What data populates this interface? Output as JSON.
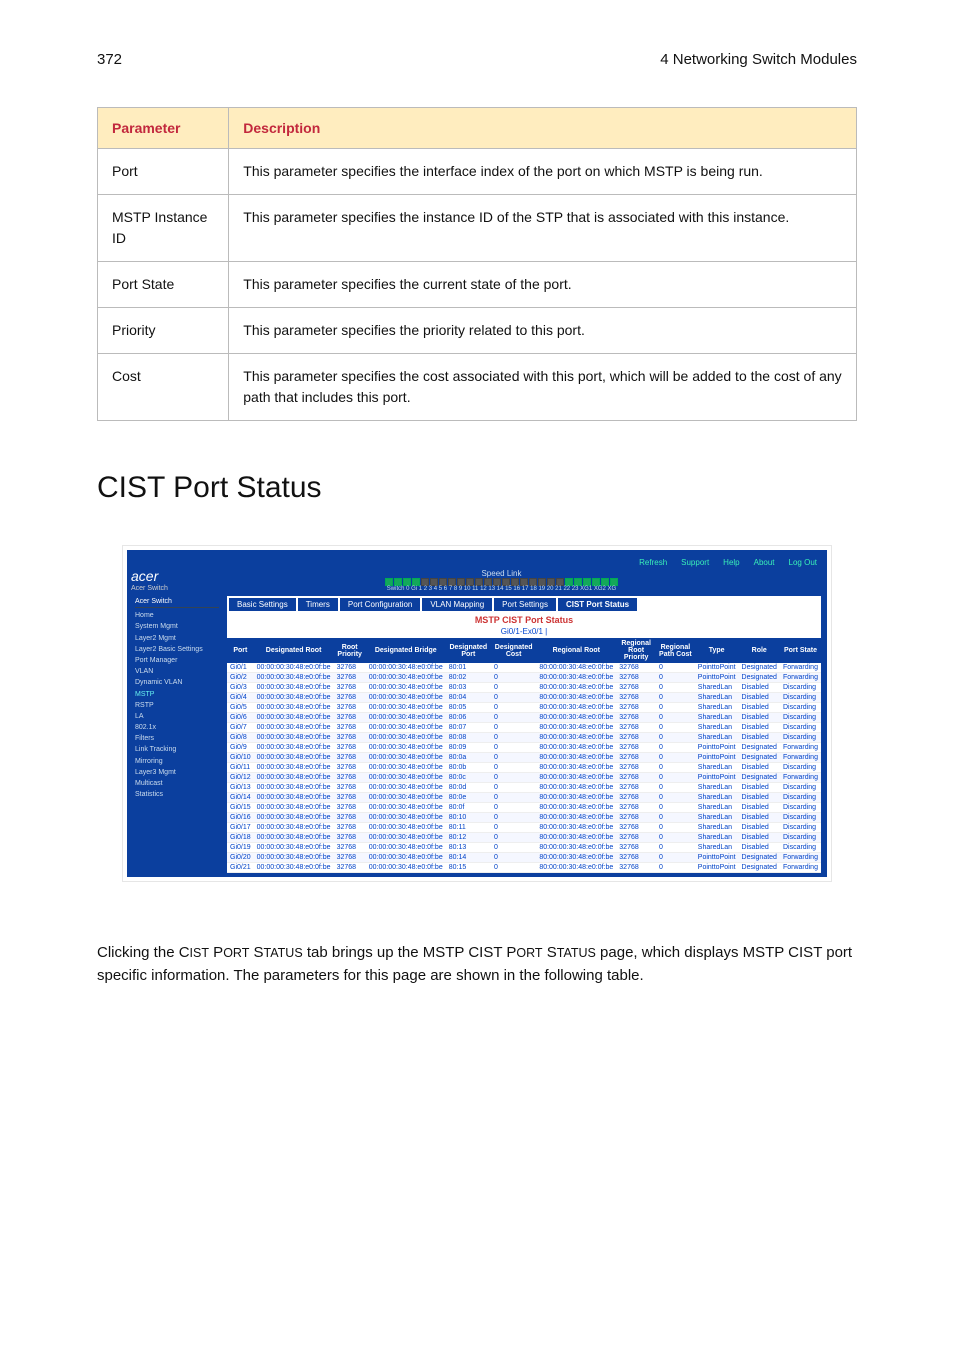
{
  "header": {
    "page_no": "372",
    "chapter": "4 Networking Switch Modules"
  },
  "table": {
    "cols": [
      "Parameter",
      "Description"
    ],
    "rows": [
      {
        "param": "Port",
        "desc": "This parameter specifies the interface index of the port on which MSTP is being run."
      },
      {
        "param": "MSTP Instance ID",
        "desc": "This parameter specifies the instance ID of the STP that is associated with this instance."
      },
      {
        "param": "Port State",
        "desc": "This parameter specifies the current state of the port."
      },
      {
        "param": "Priority",
        "desc": "This parameter specifies the priority related to this port."
      },
      {
        "param": "Cost",
        "desc": "This parameter specifies the cost associated with this port, which will be added to the cost of any path that includes this port."
      }
    ]
  },
  "section_title": "CIST Port Status",
  "screenshot": {
    "brand": "acer",
    "brand_sub": "Acer Switch",
    "top_links": [
      "Refresh",
      "Support",
      "Help",
      "About",
      "Log Out"
    ],
    "speed_label": "Speed Link",
    "speed_caption": "Switch 0 Gi 1 2 3 4 5 6 7 8 9 10 11 12 13 14 15 16 17 18 19 20 21 22 23 XG1 XG2 XG",
    "side_top": "Acer Switch",
    "tabs": [
      "Basic Settings",
      "Timers",
      "Port Configuration",
      "VLAN Mapping",
      "Port Settings",
      "CIST Port Status"
    ],
    "subheader": "MSTP CIST Port Status",
    "link": "Gi0/1-Ex0/1 |",
    "side_items": [
      "Home",
      "System Mgmt",
      "Layer2 Mgmt",
      "Layer2 Basic Settings",
      "Port Manager",
      "VLAN",
      "Dynamic VLAN",
      "MSTP",
      "RSTP",
      "LA",
      "802.1x",
      "Filters",
      "Link Tracking",
      "Mirroring",
      "Layer3 Mgmt",
      "Multicast",
      "Statistics"
    ],
    "cols": [
      "Port",
      "Designated Root",
      "Root Priority",
      "Designated Bridge",
      "Designated Port",
      "Designated Cost",
      "Regional Root",
      "Regional Root Priority",
      "Regional Path Cost",
      "Type",
      "Role",
      "Port State"
    ],
    "rows": [
      {
        "port": "Gi0/1",
        "droot": "00:00:00:30:48:e0:0f:be",
        "rp": "32768",
        "dbridge": "00:00:00:30:48:e0:0f:be",
        "dport": "80:01",
        "dcost": "0",
        "rr": "80:00:00:30:48:e0:0f:be",
        "rrp": "32768",
        "rpc": "0",
        "type": "PointtoPoint",
        "role": "Designated",
        "state": "Forwarding"
      },
      {
        "port": "Gi0/2",
        "droot": "00:00:00:30:48:e0:0f:be",
        "rp": "32768",
        "dbridge": "00:00:00:30:48:e0:0f:be",
        "dport": "80:02",
        "dcost": "0",
        "rr": "80:00:00:30:48:e0:0f:be",
        "rrp": "32768",
        "rpc": "0",
        "type": "PointtoPoint",
        "role": "Designated",
        "state": "Forwarding"
      },
      {
        "port": "Gi0/3",
        "droot": "00:00:00:30:48:e0:0f:be",
        "rp": "32768",
        "dbridge": "00:00:00:30:48:e0:0f:be",
        "dport": "80:03",
        "dcost": "0",
        "rr": "80:00:00:30:48:e0:0f:be",
        "rrp": "32768",
        "rpc": "0",
        "type": "SharedLan",
        "role": "Disabled",
        "state": "Discarding"
      },
      {
        "port": "Gi0/4",
        "droot": "00:00:00:30:48:e0:0f:be",
        "rp": "32768",
        "dbridge": "00:00:00:30:48:e0:0f:be",
        "dport": "80:04",
        "dcost": "0",
        "rr": "80:00:00:30:48:e0:0f:be",
        "rrp": "32768",
        "rpc": "0",
        "type": "SharedLan",
        "role": "Disabled",
        "state": "Discarding"
      },
      {
        "port": "Gi0/5",
        "droot": "00:00:00:30:48:e0:0f:be",
        "rp": "32768",
        "dbridge": "00:00:00:30:48:e0:0f:be",
        "dport": "80:05",
        "dcost": "0",
        "rr": "80:00:00:30:48:e0:0f:be",
        "rrp": "32768",
        "rpc": "0",
        "type": "SharedLan",
        "role": "Disabled",
        "state": "Discarding"
      },
      {
        "port": "Gi0/6",
        "droot": "00:00:00:30:48:e0:0f:be",
        "rp": "32768",
        "dbridge": "00:00:00:30:48:e0:0f:be",
        "dport": "80:06",
        "dcost": "0",
        "rr": "80:00:00:30:48:e0:0f:be",
        "rrp": "32768",
        "rpc": "0",
        "type": "SharedLan",
        "role": "Disabled",
        "state": "Discarding"
      },
      {
        "port": "Gi0/7",
        "droot": "00:00:00:30:48:e0:0f:be",
        "rp": "32768",
        "dbridge": "00:00:00:30:48:e0:0f:be",
        "dport": "80:07",
        "dcost": "0",
        "rr": "80:00:00:30:48:e0:0f:be",
        "rrp": "32768",
        "rpc": "0",
        "type": "SharedLan",
        "role": "Disabled",
        "state": "Discarding"
      },
      {
        "port": "Gi0/8",
        "droot": "00:00:00:30:48:e0:0f:be",
        "rp": "32768",
        "dbridge": "00:00:00:30:48:e0:0f:be",
        "dport": "80:08",
        "dcost": "0",
        "rr": "80:00:00:30:48:e0:0f:be",
        "rrp": "32768",
        "rpc": "0",
        "type": "SharedLan",
        "role": "Disabled",
        "state": "Discarding"
      },
      {
        "port": "Gi0/9",
        "droot": "00:00:00:30:48:e0:0f:be",
        "rp": "32768",
        "dbridge": "00:00:00:30:48:e0:0f:be",
        "dport": "80:09",
        "dcost": "0",
        "rr": "80:00:00:30:48:e0:0f:be",
        "rrp": "32768",
        "rpc": "0",
        "type": "PointtoPoint",
        "role": "Designated",
        "state": "Forwarding"
      },
      {
        "port": "Gi0/10",
        "droot": "00:00:00:30:48:e0:0f:be",
        "rp": "32768",
        "dbridge": "00:00:00:30:48:e0:0f:be",
        "dport": "80:0a",
        "dcost": "0",
        "rr": "80:00:00:30:48:e0:0f:be",
        "rrp": "32768",
        "rpc": "0",
        "type": "PointtoPoint",
        "role": "Designated",
        "state": "Forwarding"
      },
      {
        "port": "Gi0/11",
        "droot": "00:00:00:30:48:e0:0f:be",
        "rp": "32768",
        "dbridge": "00:00:00:30:48:e0:0f:be",
        "dport": "80:0b",
        "dcost": "0",
        "rr": "80:00:00:30:48:e0:0f:be",
        "rrp": "32768",
        "rpc": "0",
        "type": "SharedLan",
        "role": "Disabled",
        "state": "Discarding"
      },
      {
        "port": "Gi0/12",
        "droot": "00:00:00:30:48:e0:0f:be",
        "rp": "32768",
        "dbridge": "00:00:00:30:48:e0:0f:be",
        "dport": "80:0c",
        "dcost": "0",
        "rr": "80:00:00:30:48:e0:0f:be",
        "rrp": "32768",
        "rpc": "0",
        "type": "PointtoPoint",
        "role": "Designated",
        "state": "Forwarding"
      },
      {
        "port": "Gi0/13",
        "droot": "00:00:00:30:48:e0:0f:be",
        "rp": "32768",
        "dbridge": "00:00:00:30:48:e0:0f:be",
        "dport": "80:0d",
        "dcost": "0",
        "rr": "80:00:00:30:48:e0:0f:be",
        "rrp": "32768",
        "rpc": "0",
        "type": "SharedLan",
        "role": "Disabled",
        "state": "Discarding"
      },
      {
        "port": "Gi0/14",
        "droot": "00:00:00:30:48:e0:0f:be",
        "rp": "32768",
        "dbridge": "00:00:00:30:48:e0:0f:be",
        "dport": "80:0e",
        "dcost": "0",
        "rr": "80:00:00:30:48:e0:0f:be",
        "rrp": "32768",
        "rpc": "0",
        "type": "SharedLan",
        "role": "Disabled",
        "state": "Discarding"
      },
      {
        "port": "Gi0/15",
        "droot": "00:00:00:30:48:e0:0f:be",
        "rp": "32768",
        "dbridge": "00:00:00:30:48:e0:0f:be",
        "dport": "80:0f",
        "dcost": "0",
        "rr": "80:00:00:30:48:e0:0f:be",
        "rrp": "32768",
        "rpc": "0",
        "type": "SharedLan",
        "role": "Disabled",
        "state": "Discarding"
      },
      {
        "port": "Gi0/16",
        "droot": "00:00:00:30:48:e0:0f:be",
        "rp": "32768",
        "dbridge": "00:00:00:30:48:e0:0f:be",
        "dport": "80:10",
        "dcost": "0",
        "rr": "80:00:00:30:48:e0:0f:be",
        "rrp": "32768",
        "rpc": "0",
        "type": "SharedLan",
        "role": "Disabled",
        "state": "Discarding"
      },
      {
        "port": "Gi0/17",
        "droot": "00:00:00:30:48:e0:0f:be",
        "rp": "32768",
        "dbridge": "00:00:00:30:48:e0:0f:be",
        "dport": "80:11",
        "dcost": "0",
        "rr": "80:00:00:30:48:e0:0f:be",
        "rrp": "32768",
        "rpc": "0",
        "type": "SharedLan",
        "role": "Disabled",
        "state": "Discarding"
      },
      {
        "port": "Gi0/18",
        "droot": "00:00:00:30:48:e0:0f:be",
        "rp": "32768",
        "dbridge": "00:00:00:30:48:e0:0f:be",
        "dport": "80:12",
        "dcost": "0",
        "rr": "80:00:00:30:48:e0:0f:be",
        "rrp": "32768",
        "rpc": "0",
        "type": "SharedLan",
        "role": "Disabled",
        "state": "Discarding"
      },
      {
        "port": "Gi0/19",
        "droot": "00:00:00:30:48:e0:0f:be",
        "rp": "32768",
        "dbridge": "00:00:00:30:48:e0:0f:be",
        "dport": "80:13",
        "dcost": "0",
        "rr": "80:00:00:30:48:e0:0f:be",
        "rrp": "32768",
        "rpc": "0",
        "type": "SharedLan",
        "role": "Disabled",
        "state": "Discarding"
      },
      {
        "port": "Gi0/20",
        "droot": "00:00:00:30:48:e0:0f:be",
        "rp": "32768",
        "dbridge": "00:00:00:30:48:e0:0f:be",
        "dport": "80:14",
        "dcost": "0",
        "rr": "80:00:00:30:48:e0:0f:be",
        "rrp": "32768",
        "rpc": "0",
        "type": "PointtoPoint",
        "role": "Designated",
        "state": "Forwarding"
      },
      {
        "port": "Gi0/21",
        "droot": "00:00:00:30:48:e0:0f:be",
        "rp": "32768",
        "dbridge": "00:00:00:30:48:e0:0f:be",
        "dport": "80:15",
        "dcost": "0",
        "rr": "80:00:00:30:48:e0:0f:be",
        "rrp": "32768",
        "rpc": "0",
        "type": "PointtoPoint",
        "role": "Designated",
        "state": "Forwarding"
      }
    ]
  },
  "body_text": "Clicking the CIST PORT STATUS tab brings up the MSTP CIST PORT STATUS page, which displays MSTP CIST port specific information. The parameters for this page are shown in the following table."
}
